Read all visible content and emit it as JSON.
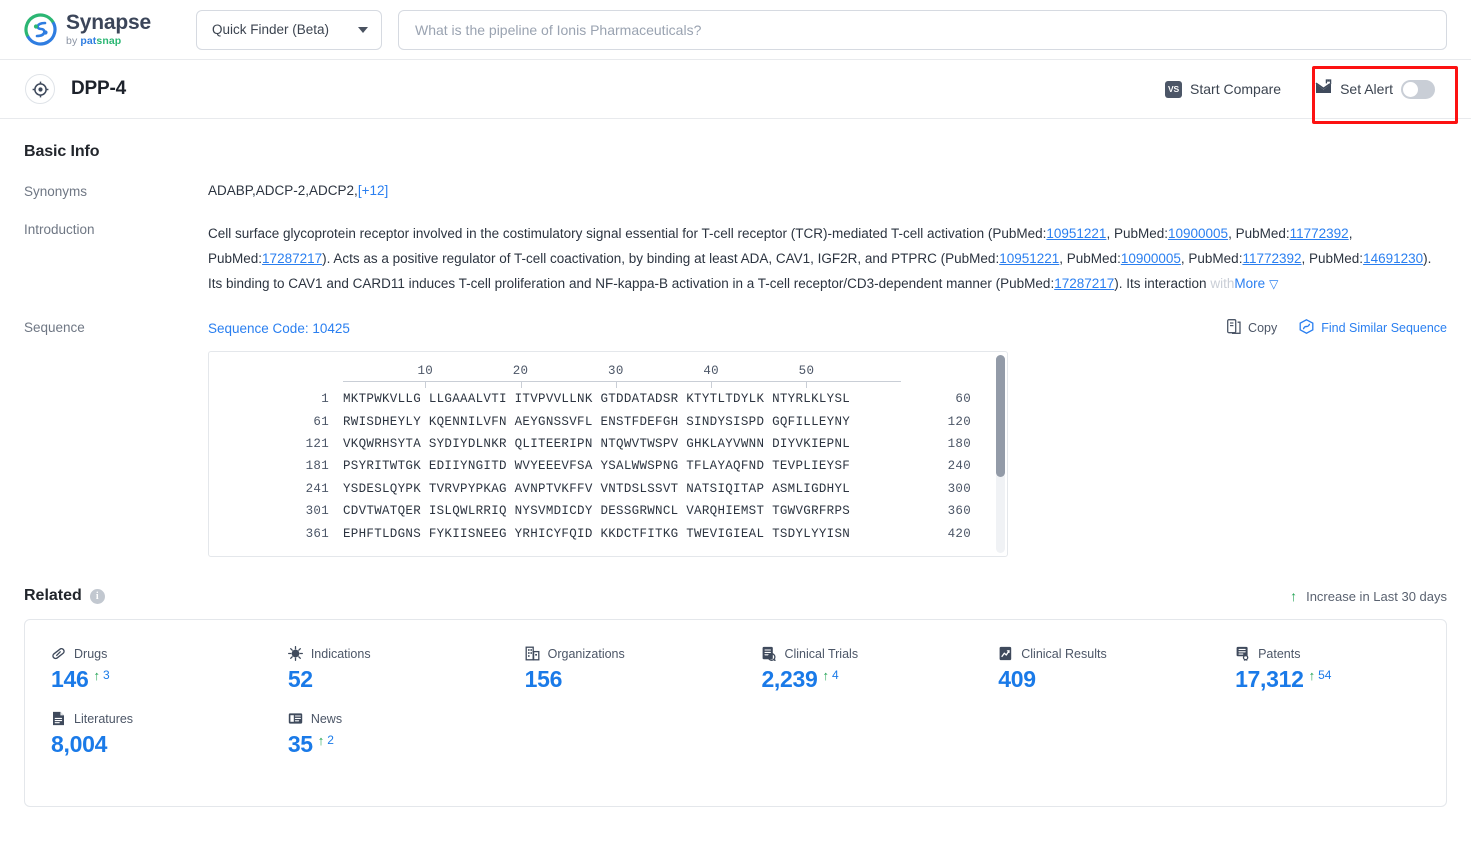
{
  "topbar": {
    "logo_title": "Synapse",
    "logo_by": "by ",
    "logo_pat": "pat",
    "logo_snap": "snap",
    "finder_label": "Quick Finder (Beta)",
    "search_placeholder": "What is the pipeline of Ionis Pharmaceuticals?",
    "search_value": ""
  },
  "subheader": {
    "title": "DPP-4",
    "vs_badge": "VS",
    "compare_label": "Start Compare",
    "alert_label": "Set Alert",
    "alert_enabled": false
  },
  "basic_info": {
    "section_title": "Basic Info",
    "synonyms_label": "Synonyms",
    "synonyms_value": "ADABP,ADCP-2,ADCP2,",
    "synonyms_more": "[+12]",
    "introduction_label": "Introduction",
    "introduction": {
      "p1": "Cell surface glycoprotein receptor involved in the costimulatory signal essential for T-cell receptor (TCR)-mediated T-cell activation (PubMed:",
      "ref1": "10951221",
      "p2": ", PubMed:",
      "ref2": "10900005",
      "p3": ", PubMed:",
      "ref3": "11772392",
      "p4": ", PubMed:",
      "ref4": "17287217",
      "p5": "). Acts as a positive regulator of T-cell coactivation, by binding at least ADA, CAV1, IGF2R, and PTPRC (PubMed:",
      "ref5": "10951221",
      "p6": ", PubMed:",
      "ref6": "10900005",
      "p7": ", PubMed:",
      "ref7": "11772392",
      "p8": ", PubMed:",
      "ref8": "14691230",
      "p9": "). Its binding to CAV1 and CARD11 induces T-cell proliferation and NF-kappa-B activation in a T-cell receptor/CD3-dependent manner (PubMed:",
      "ref9": "17287217",
      "p10": "). Its interaction ",
      "faded": "with",
      "more_label": "More",
      "more_chevron": "❯"
    }
  },
  "sequence": {
    "row_label": "Sequence",
    "code_label": "Sequence Code: 10425",
    "copy_label": "Copy",
    "find_label": "Find Similar Sequence",
    "ruler_ticks": [
      10,
      20,
      30,
      40,
      50
    ],
    "rows": [
      {
        "start": "1",
        "letters": "MKTPWKVLLG LLGAAALVTI ITVPVVLLNK GTDDATADSR KTYTLTDYLK NTYRLKLYSL",
        "end": "60"
      },
      {
        "start": "61",
        "letters": "RWISDHEYLY KQENNILVFN AEYGNSSVFL ENSTFDEFGH SINDYSISPD GQFILLEYNY",
        "end": "120"
      },
      {
        "start": "121",
        "letters": "VKQWRHSYTA SYDIYDLNKR QLITEERIPN NTQWVTWSPV GHKLAYVWNN DIYVKIEPNL",
        "end": "180"
      },
      {
        "start": "181",
        "letters": "PSYRITWTGK EDIIYNGITD WVYEEEVFSA YSALWWSPNG TFLAYAQFND TEVPLIEYSF",
        "end": "240"
      },
      {
        "start": "241",
        "letters": "YSDESLQYPK TVRVPYPKAG AVNPTVKFFV VNTDSLSSVT NATSIQITAP ASMLIGDHYL",
        "end": "300"
      },
      {
        "start": "301",
        "letters": "CDVTWATQER ISLQWLRRIQ NYSVMDICDY DESSGRWNCL VARQHIEMST TGWVGRFRPS",
        "end": "360"
      },
      {
        "start": "361",
        "letters": "EPHFTLDGNS FYKIISNEEG YRHICYFQID KKDCTFITKG TWEVIGIEAL TSDYLYYISN",
        "end": "420"
      }
    ]
  },
  "related": {
    "title": "Related",
    "info_icon": "i",
    "increase_label": "Increase in Last 30 days",
    "increase_arrow": "↑",
    "stats": [
      {
        "label": "Drugs",
        "icon": "pill-icon",
        "value": "146",
        "delta": "3"
      },
      {
        "label": "Indications",
        "icon": "virus-icon",
        "value": "52",
        "delta": ""
      },
      {
        "label": "Organizations",
        "icon": "building-icon",
        "value": "156",
        "delta": ""
      },
      {
        "label": "Clinical Trials",
        "icon": "clinical-trial-icon",
        "value": "2,239",
        "delta": "4"
      },
      {
        "label": "Clinical Results",
        "icon": "clinical-result-icon",
        "value": "409",
        "delta": ""
      },
      {
        "label": "Patents",
        "icon": "patent-icon",
        "value": "17,312",
        "delta": "54"
      },
      {
        "label": "Literatures",
        "icon": "literature-icon",
        "value": "8,004",
        "delta": ""
      },
      {
        "label": "News",
        "icon": "news-icon",
        "value": "35",
        "delta": "2"
      }
    ]
  },
  "colors": {
    "link": "#2a7ff0",
    "stat_value": "#1a7ae8",
    "increase_green": "#23a455",
    "highlight_red": "#fc1212"
  }
}
